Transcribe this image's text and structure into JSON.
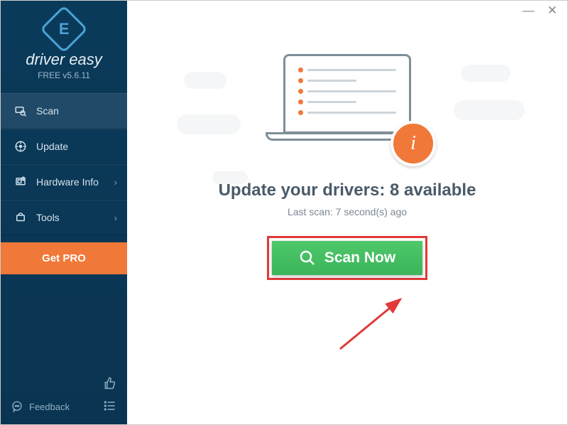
{
  "app": {
    "name": "driver easy",
    "version": "FREE v5.6.11"
  },
  "sidebar": {
    "items": [
      {
        "label": "Scan",
        "icon": "scan-icon"
      },
      {
        "label": "Update",
        "icon": "update-icon"
      },
      {
        "label": "Hardware Info",
        "icon": "hardware-icon"
      },
      {
        "label": "Tools",
        "icon": "tools-icon"
      }
    ],
    "get_pro": "Get PRO",
    "feedback": "Feedback"
  },
  "main": {
    "headline_prefix": "Update your drivers: ",
    "available_count": "8",
    "headline_suffix": " available",
    "last_scan": "Last scan: 7 second(s) ago",
    "scan_button": "Scan Now"
  },
  "colors": {
    "accent_orange": "#f07838",
    "accent_green": "#3bb45b",
    "sidebar_bg": "#0a3a5a",
    "annotation_red": "#e03a3a"
  }
}
